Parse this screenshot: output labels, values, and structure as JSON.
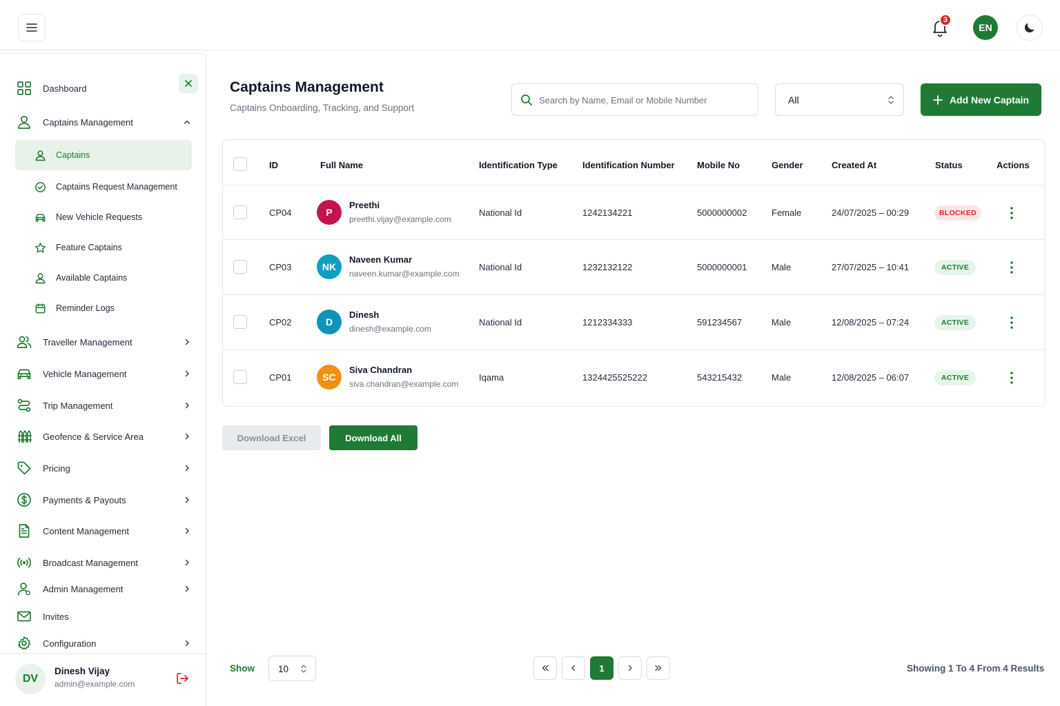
{
  "topbar": {
    "notification_count": "3",
    "language": "EN"
  },
  "sidebar": {
    "items": [
      {
        "label": "Dashboard",
        "icon": "grid-icon"
      },
      {
        "label": "Captains Management",
        "icon": "user-icon",
        "expanded": true
      },
      {
        "label": "Traveller Management",
        "icon": "users-icon"
      },
      {
        "label": "Vehicle Management",
        "icon": "car-icon"
      },
      {
        "label": "Trip Management",
        "icon": "route-icon"
      },
      {
        "label": "Geofence & Service Area",
        "icon": "fence-icon"
      },
      {
        "label": "Pricing",
        "icon": "tag-icon"
      },
      {
        "label": "Payments & Payouts",
        "icon": "dollar-icon"
      },
      {
        "label": "Content Management",
        "icon": "document-icon"
      },
      {
        "label": "Broadcast Management",
        "icon": "broadcast-icon"
      },
      {
        "label": "Admin Management",
        "icon": "admin-icon"
      },
      {
        "label": "Invites",
        "icon": "mail-icon"
      },
      {
        "label": "Configuration",
        "icon": "gear-icon"
      }
    ],
    "sub_items": [
      {
        "label": "Captains",
        "icon": "user-icon",
        "active": true
      },
      {
        "label": "Captains Request Management",
        "icon": "check-circle-icon"
      },
      {
        "label": "New Vehicle Requests",
        "icon": "car-icon"
      },
      {
        "label": "Feature Captains",
        "icon": "star-icon"
      },
      {
        "label": "Available Captains",
        "icon": "user-icon"
      },
      {
        "label": "Reminder Logs",
        "icon": "calendar-icon"
      }
    ],
    "user": {
      "initials": "DV",
      "name": "Dinesh Vijay",
      "email": "admin@example.com"
    }
  },
  "main": {
    "title": "Captains Management",
    "subtitle": "Captains Onboarding, Tracking, and Support",
    "search_placeholder": "Search by Name, Email or Mobile Number",
    "filter_value": "All",
    "add_button": "Add New Captain",
    "table": {
      "columns": [
        "ID",
        "Full Name",
        "Identification Type",
        "Identification Number",
        "Mobile No",
        "Gender",
        "Created At",
        "Status",
        "Actions"
      ],
      "rows": [
        {
          "id": "CP04",
          "initials": "P",
          "avatar_color": "#c2134f",
          "name": "Preethi",
          "email": "preethi.vijay@example.com",
          "id_type": "National Id",
          "id_number": "1242134221",
          "mobile": "5000000002",
          "gender": "Female",
          "created": "24/07/2025 – 00:29",
          "status": "BLOCKED"
        },
        {
          "id": "CP03",
          "initials": "NK",
          "avatar_color": "#0e9fbf",
          "name": "Naveen Kumar",
          "email": "naveen.kumar@example.com",
          "id_type": "National Id",
          "id_number": "1232132122",
          "mobile": "5000000001",
          "gender": "Male",
          "created": "27/07/2025 – 10:41",
          "status": "ACTIVE"
        },
        {
          "id": "CP02",
          "initials": "D",
          "avatar_color": "#0e94b8",
          "name": "Dinesh",
          "email": "dinesh@example.com",
          "id_type": "National Id",
          "id_number": "1212334333",
          "mobile": "591234567",
          "gender": "Male",
          "created": "12/08/2025 – 07:24",
          "status": "ACTIVE"
        },
        {
          "id": "CP01",
          "initials": "SC",
          "avatar_color": "#f29111",
          "name": "Siva Chandran",
          "email": "siva.chandran@example.com",
          "id_type": "Iqama",
          "id_number": "1324425525222",
          "mobile": "543215432",
          "gender": "Male",
          "created": "12/08/2025 – 06:07",
          "status": "ACTIVE"
        }
      ]
    },
    "download_excel": "Download Excel",
    "download_all": "Download All"
  },
  "pagination": {
    "show_label": "Show",
    "page_size": "10",
    "current_page": "1",
    "results_text": "Showing 1 To 4 From 4 Results"
  },
  "colors": {
    "accent": "#1e7a34",
    "accent_light": "#e8f2ea",
    "blocked": "#dc2626"
  }
}
